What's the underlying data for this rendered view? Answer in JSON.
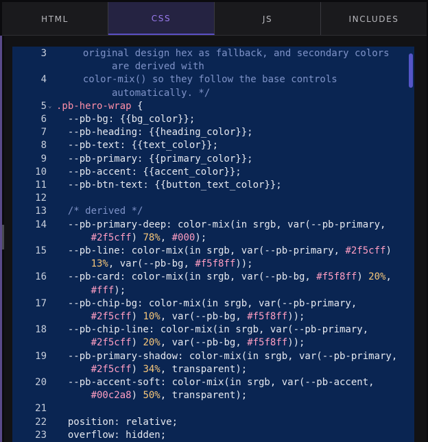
{
  "tabs": [
    {
      "label": "HTML",
      "active": false
    },
    {
      "label": "CSS",
      "active": true
    },
    {
      "label": "JS",
      "active": false
    },
    {
      "label": "INCLUDES",
      "active": false
    }
  ],
  "colors": {
    "accent": "#9b7cf0",
    "editor_bg": "#0a2552",
    "comment": "#7f93c8",
    "selector": "#ff8fa8",
    "hex": "#ff9ec3",
    "number": "#f7c77a"
  },
  "icons": {
    "fold": "chevron-down-icon"
  },
  "editor": {
    "lines": [
      {
        "num": "3",
        "fold": "",
        "segs": [
          {
            "t": "  original design hex as fallback, and secondary colors",
            "c": "cmt"
          }
        ]
      },
      {
        "num": "",
        "fold": "",
        "segs": [
          {
            "t": "       are derived with",
            "c": "cmt"
          }
        ]
      },
      {
        "num": "4",
        "fold": "",
        "segs": [
          {
            "t": "  color-mix() so they follow the base controls",
            "c": "cmt"
          }
        ]
      },
      {
        "num": "",
        "fold": "",
        "segs": [
          {
            "t": "       automatically. */",
            "c": "cmt"
          }
        ]
      },
      {
        "num": "5",
        "fold": "⌄",
        "segs": [
          {
            "t": ".pb-hero-wrap",
            "c": "sel"
          },
          {
            "t": " {",
            "c": ""
          }
        ]
      },
      {
        "num": "6",
        "fold": "",
        "segs": [
          {
            "t": "  --pb-bg: {{bg_color}};",
            "c": ""
          }
        ]
      },
      {
        "num": "7",
        "fold": "",
        "segs": [
          {
            "t": "  --pb-heading: {{heading_color}};",
            "c": ""
          }
        ]
      },
      {
        "num": "8",
        "fold": "",
        "segs": [
          {
            "t": "  --pb-text: {{text_color}};",
            "c": ""
          }
        ]
      },
      {
        "num": "9",
        "fold": "",
        "segs": [
          {
            "t": "  --pb-primary: {{primary_color}};",
            "c": ""
          }
        ]
      },
      {
        "num": "10",
        "fold": "",
        "segs": [
          {
            "t": "  --pb-accent: {{accent_color}};",
            "c": ""
          }
        ]
      },
      {
        "num": "11",
        "fold": "",
        "segs": [
          {
            "t": "  --pb-btn-text: {{button_text_color}};",
            "c": ""
          }
        ]
      },
      {
        "num": "12",
        "fold": "",
        "segs": []
      },
      {
        "num": "13",
        "fold": "",
        "segs": [
          {
            "t": "  /* derived */",
            "c": "cmt"
          }
        ]
      },
      {
        "num": "14",
        "fold": "",
        "segs": [
          {
            "t": "  --pb-primary-deep: color-mix(in srgb, var(--pb-primary,",
            "c": ""
          }
        ]
      },
      {
        "num": "",
        "fold": "",
        "segs": [
          {
            "t": "      ",
            "c": ""
          },
          {
            "t": "#2f5cff",
            "c": "hex"
          },
          {
            "t": ") ",
            "c": ""
          },
          {
            "t": "78%",
            "c": "num"
          },
          {
            "t": ", ",
            "c": ""
          },
          {
            "t": "#000",
            "c": "hex"
          },
          {
            "t": ");",
            "c": ""
          }
        ]
      },
      {
        "num": "15",
        "fold": "",
        "segs": [
          {
            "t": "  --pb-line: color-mix(in srgb, var(--pb-primary, ",
            "c": ""
          },
          {
            "t": "#2f5cff",
            "c": "hex"
          },
          {
            "t": ")",
            "c": ""
          }
        ]
      },
      {
        "num": "",
        "fold": "",
        "segs": [
          {
            "t": "      ",
            "c": ""
          },
          {
            "t": "13%",
            "c": "num"
          },
          {
            "t": ", var(--pb-bg, ",
            "c": ""
          },
          {
            "t": "#f5f8ff",
            "c": "hex"
          },
          {
            "t": "));",
            "c": ""
          }
        ]
      },
      {
        "num": "16",
        "fold": "",
        "segs": [
          {
            "t": "  --pb-card: color-mix(in srgb, var(--pb-bg, ",
            "c": ""
          },
          {
            "t": "#f5f8ff",
            "c": "hex"
          },
          {
            "t": ") ",
            "c": ""
          },
          {
            "t": "20%",
            "c": "num"
          },
          {
            "t": ",",
            "c": ""
          }
        ]
      },
      {
        "num": "",
        "fold": "",
        "segs": [
          {
            "t": "      ",
            "c": ""
          },
          {
            "t": "#fff",
            "c": "hex"
          },
          {
            "t": ");",
            "c": ""
          }
        ]
      },
      {
        "num": "17",
        "fold": "",
        "segs": [
          {
            "t": "  --pb-chip-bg: color-mix(in srgb, var(--pb-primary,",
            "c": ""
          }
        ]
      },
      {
        "num": "",
        "fold": "",
        "segs": [
          {
            "t": "      ",
            "c": ""
          },
          {
            "t": "#2f5cff",
            "c": "hex"
          },
          {
            "t": ") ",
            "c": ""
          },
          {
            "t": "10%",
            "c": "num"
          },
          {
            "t": ", var(--pb-bg, ",
            "c": ""
          },
          {
            "t": "#f5f8ff",
            "c": "hex"
          },
          {
            "t": "));",
            "c": ""
          }
        ]
      },
      {
        "num": "18",
        "fold": "",
        "segs": [
          {
            "t": "  --pb-chip-line: color-mix(in srgb, var(--pb-primary,",
            "c": ""
          }
        ]
      },
      {
        "num": "",
        "fold": "",
        "segs": [
          {
            "t": "      ",
            "c": ""
          },
          {
            "t": "#2f5cff",
            "c": "hex"
          },
          {
            "t": ") ",
            "c": ""
          },
          {
            "t": "20%",
            "c": "num"
          },
          {
            "t": ", var(--pb-bg, ",
            "c": ""
          },
          {
            "t": "#f5f8ff",
            "c": "hex"
          },
          {
            "t": "));",
            "c": ""
          }
        ]
      },
      {
        "num": "19",
        "fold": "",
        "segs": [
          {
            "t": "  --pb-primary-shadow: color-mix(in srgb, var(--pb-primary,",
            "c": ""
          }
        ]
      },
      {
        "num": "",
        "fold": "",
        "segs": [
          {
            "t": "      ",
            "c": ""
          },
          {
            "t": "#2f5cff",
            "c": "hex"
          },
          {
            "t": ") ",
            "c": ""
          },
          {
            "t": "34%",
            "c": "num"
          },
          {
            "t": ", transparent);",
            "c": ""
          }
        ]
      },
      {
        "num": "20",
        "fold": "",
        "segs": [
          {
            "t": "  --pb-accent-soft: color-mix(in srgb, var(--pb-accent,",
            "c": ""
          }
        ]
      },
      {
        "num": "",
        "fold": "",
        "segs": [
          {
            "t": "      ",
            "c": ""
          },
          {
            "t": "#00c2a8",
            "c": "hex"
          },
          {
            "t": ") ",
            "c": ""
          },
          {
            "t": "50%",
            "c": "num"
          },
          {
            "t": ", transparent);",
            "c": ""
          }
        ]
      },
      {
        "num": "21",
        "fold": "",
        "segs": []
      },
      {
        "num": "22",
        "fold": "",
        "segs": [
          {
            "t": "  position: relative;",
            "c": ""
          }
        ]
      },
      {
        "num": "23",
        "fold": "",
        "segs": [
          {
            "t": "  overflow: hidden;",
            "c": ""
          }
        ]
      }
    ]
  }
}
